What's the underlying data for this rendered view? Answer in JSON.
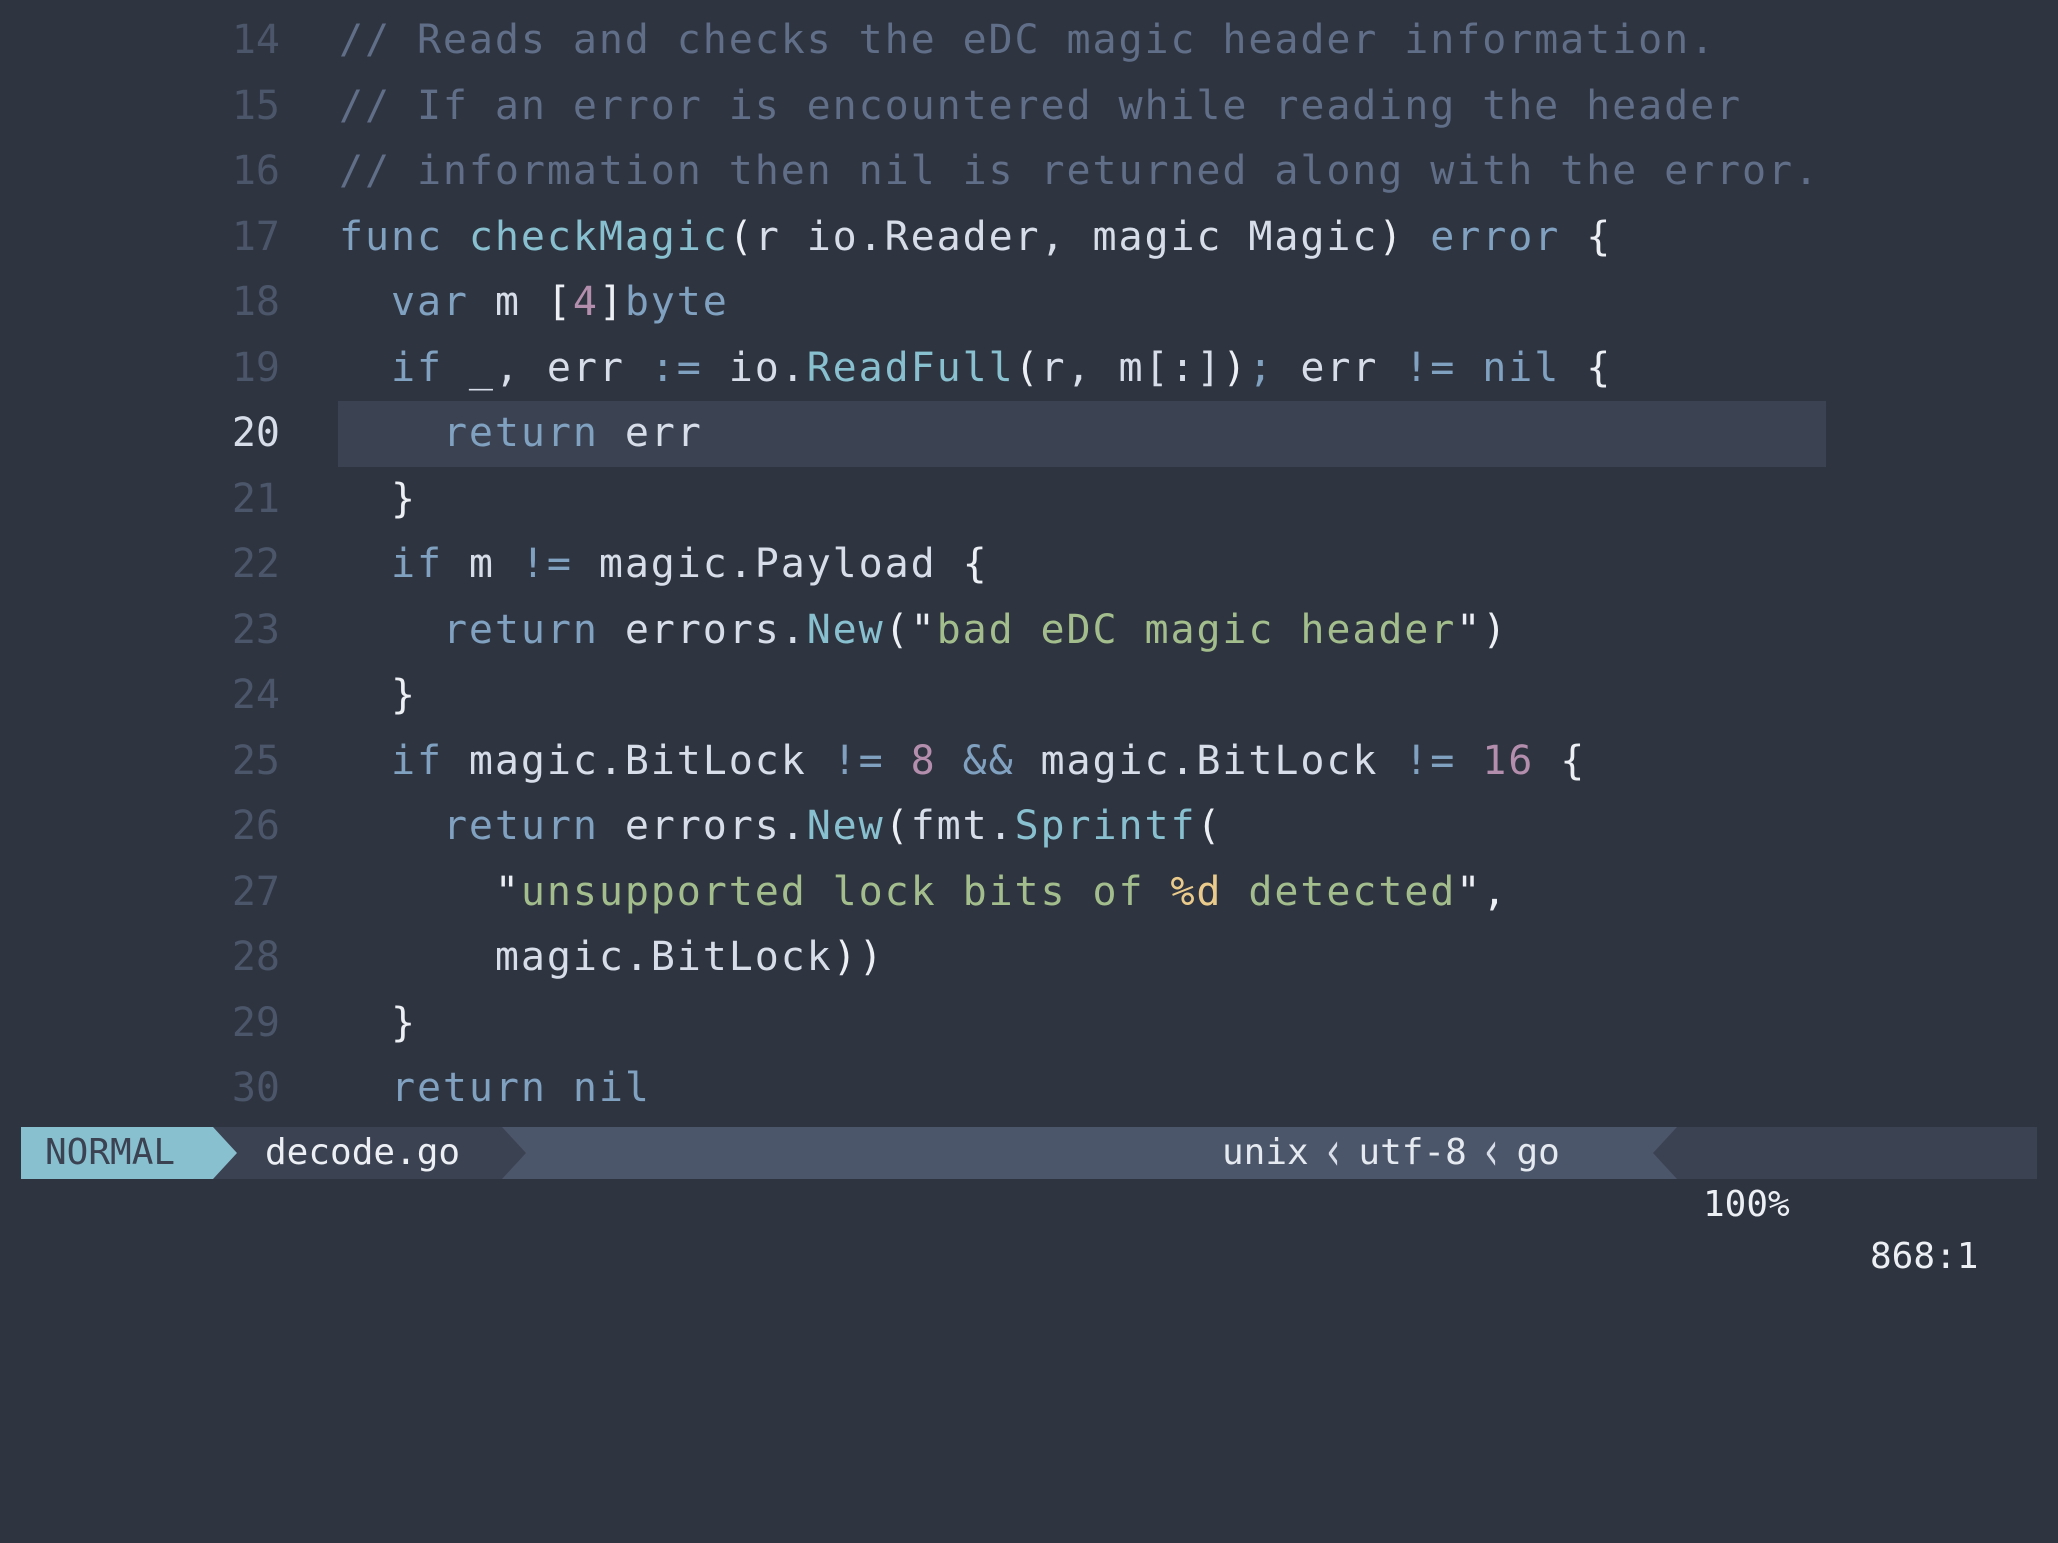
{
  "theme": {
    "background": "#2E3440",
    "cursorline": "#3B4252",
    "line_number": "#4C566A",
    "line_number_current": "#D8DEE9",
    "comment": "#616E88",
    "keyword": "#81A1C1",
    "function": "#88C0D0",
    "number": "#B48EAD",
    "string": "#A3BE8C",
    "format_verb": "#EBCB8B",
    "text": "#D8DEE9"
  },
  "editor": {
    "current_line": 20,
    "lines": [
      {
        "n": "14",
        "tokens": [
          [
            "comment",
            "// Reads and checks the eDC magic header information."
          ]
        ]
      },
      {
        "n": "15",
        "tokens": [
          [
            "comment",
            "// If an error is encountered while reading the header"
          ]
        ]
      },
      {
        "n": "16",
        "tokens": [
          [
            "comment",
            "// information then nil is returned along with the error."
          ]
        ]
      },
      {
        "n": "17",
        "tokens": [
          [
            "kw",
            "func"
          ],
          [
            "txt",
            " "
          ],
          [
            "fn",
            "checkMagic"
          ],
          [
            "punc",
            "("
          ],
          [
            "txt",
            "r io.Reader, magic Magic"
          ],
          [
            "punc",
            ")"
          ],
          [
            "txt",
            " "
          ],
          [
            "kw",
            "error"
          ],
          [
            "txt",
            " "
          ],
          [
            "punc",
            "{"
          ]
        ]
      },
      {
        "n": "18",
        "tokens": [
          [
            "txt",
            "  "
          ],
          [
            "kw",
            "var"
          ],
          [
            "txt",
            " m "
          ],
          [
            "punc",
            "["
          ],
          [
            "num",
            "4"
          ],
          [
            "punc",
            "]"
          ],
          [
            "kw",
            "byte"
          ]
        ]
      },
      {
        "n": "19",
        "tokens": [
          [
            "txt",
            "  "
          ],
          [
            "kw",
            "if"
          ],
          [
            "txt",
            " _, err "
          ],
          [
            "kw",
            ":="
          ],
          [
            "txt",
            " io."
          ],
          [
            "fn",
            "ReadFull"
          ],
          [
            "punc",
            "("
          ],
          [
            "txt",
            "r, m[:]"
          ],
          [
            "punc",
            ")"
          ],
          [
            "kw",
            ";"
          ],
          [
            "txt",
            " err "
          ],
          [
            "kw",
            "!="
          ],
          [
            "txt",
            " "
          ],
          [
            "kw",
            "nil"
          ],
          [
            "txt",
            " "
          ],
          [
            "punc",
            "{"
          ]
        ]
      },
      {
        "n": "20",
        "tokens": [
          [
            "txt",
            "    "
          ],
          [
            "kw",
            "return"
          ],
          [
            "txt",
            " err"
          ]
        ]
      },
      {
        "n": "21",
        "tokens": [
          [
            "txt",
            "  "
          ],
          [
            "punc",
            "}"
          ]
        ]
      },
      {
        "n": "22",
        "tokens": [
          [
            "txt",
            "  "
          ],
          [
            "kw",
            "if"
          ],
          [
            "txt",
            " m "
          ],
          [
            "kw",
            "!="
          ],
          [
            "txt",
            " magic.Payload "
          ],
          [
            "punc",
            "{"
          ]
        ]
      },
      {
        "n": "23",
        "tokens": [
          [
            "txt",
            "    "
          ],
          [
            "kw",
            "return"
          ],
          [
            "txt",
            " errors."
          ],
          [
            "fn",
            "New"
          ],
          [
            "punc",
            "(\""
          ],
          [
            "str",
            "bad eDC magic header"
          ],
          [
            "punc",
            "\")"
          ]
        ]
      },
      {
        "n": "24",
        "tokens": [
          [
            "txt",
            "  "
          ],
          [
            "punc",
            "}"
          ]
        ]
      },
      {
        "n": "25",
        "tokens": [
          [
            "txt",
            "  "
          ],
          [
            "kw",
            "if"
          ],
          [
            "txt",
            " magic.BitLock "
          ],
          [
            "kw",
            "!="
          ],
          [
            "txt",
            " "
          ],
          [
            "num",
            "8"
          ],
          [
            "txt",
            " "
          ],
          [
            "kw",
            "&&"
          ],
          [
            "txt",
            " magic.BitLock "
          ],
          [
            "kw",
            "!="
          ],
          [
            "txt",
            " "
          ],
          [
            "num",
            "16"
          ],
          [
            "txt",
            " "
          ],
          [
            "punc",
            "{"
          ]
        ]
      },
      {
        "n": "26",
        "tokens": [
          [
            "txt",
            "    "
          ],
          [
            "kw",
            "return"
          ],
          [
            "txt",
            " errors."
          ],
          [
            "fn",
            "New"
          ],
          [
            "punc",
            "("
          ],
          [
            "txt",
            "fmt."
          ],
          [
            "fn",
            "Sprintf"
          ],
          [
            "punc",
            "("
          ]
        ]
      },
      {
        "n": "27",
        "tokens": [
          [
            "txt",
            "      "
          ],
          [
            "punc",
            "\""
          ],
          [
            "str",
            "unsupported lock bits of "
          ],
          [
            "fmt",
            "%d"
          ],
          [
            "str",
            " detected"
          ],
          [
            "punc",
            "\","
          ]
        ]
      },
      {
        "n": "28",
        "tokens": [
          [
            "txt",
            "      magic.BitLock"
          ],
          [
            "punc",
            "))"
          ]
        ]
      },
      {
        "n": "29",
        "tokens": [
          [
            "txt",
            "  "
          ],
          [
            "punc",
            "}"
          ]
        ]
      },
      {
        "n": "30",
        "tokens": [
          [
            "txt",
            "  "
          ],
          [
            "kw",
            "return"
          ],
          [
            "txt",
            " "
          ],
          [
            "kw",
            "nil"
          ]
        ]
      }
    ]
  },
  "statusline": {
    "mode": "NORMAL",
    "filename": "decode.go",
    "fileformat": "unix",
    "encoding": "utf-8",
    "filetype": "go",
    "separator_icon": "thin-left-chevron",
    "percent": "100%",
    "position": "868:1"
  }
}
